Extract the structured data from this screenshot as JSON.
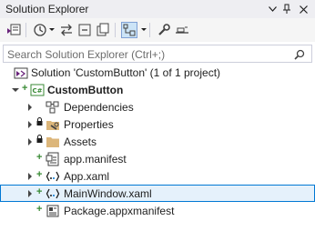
{
  "titlebar": {
    "title": "Solution Explorer",
    "dropdown_icon": "chevron-down-icon",
    "pin_icon": "pin-icon",
    "close_icon": "close-icon"
  },
  "toolbar": {
    "icons": [
      "vs-switch-views-icon",
      "history-icon",
      "sync-icon",
      "collapse-all-icon",
      "show-all-files-icon",
      "sync-active-document-icon",
      "properties-wrench-icon",
      "preview-icon"
    ]
  },
  "search": {
    "placeholder": "Search Solution Explorer (Ctrl+;)",
    "button_icon": "search-icon"
  },
  "tree": {
    "solution": "Solution 'CustomButton' (1 of 1 project)",
    "project": "CustomButton",
    "items": [
      {
        "label": "Dependencies",
        "icon": "dependencies-icon"
      },
      {
        "label": "Properties",
        "icon": "properties-folder-icon"
      },
      {
        "label": "Assets",
        "icon": "folder-icon"
      },
      {
        "label": "app.manifest",
        "icon": "manifest-icon"
      },
      {
        "label": "App.xaml",
        "icon": "xaml-icon"
      },
      {
        "label": "MainWindow.xaml",
        "icon": "xaml-icon"
      },
      {
        "label": "Package.appxmanifest",
        "icon": "appx-manifest-icon"
      }
    ]
  },
  "colors": {
    "accent": "#0078d4",
    "selection": "#e5f1fb",
    "added_glyph": "#388a34",
    "folder": "#dcb67a",
    "project_cs": "#388a34"
  }
}
